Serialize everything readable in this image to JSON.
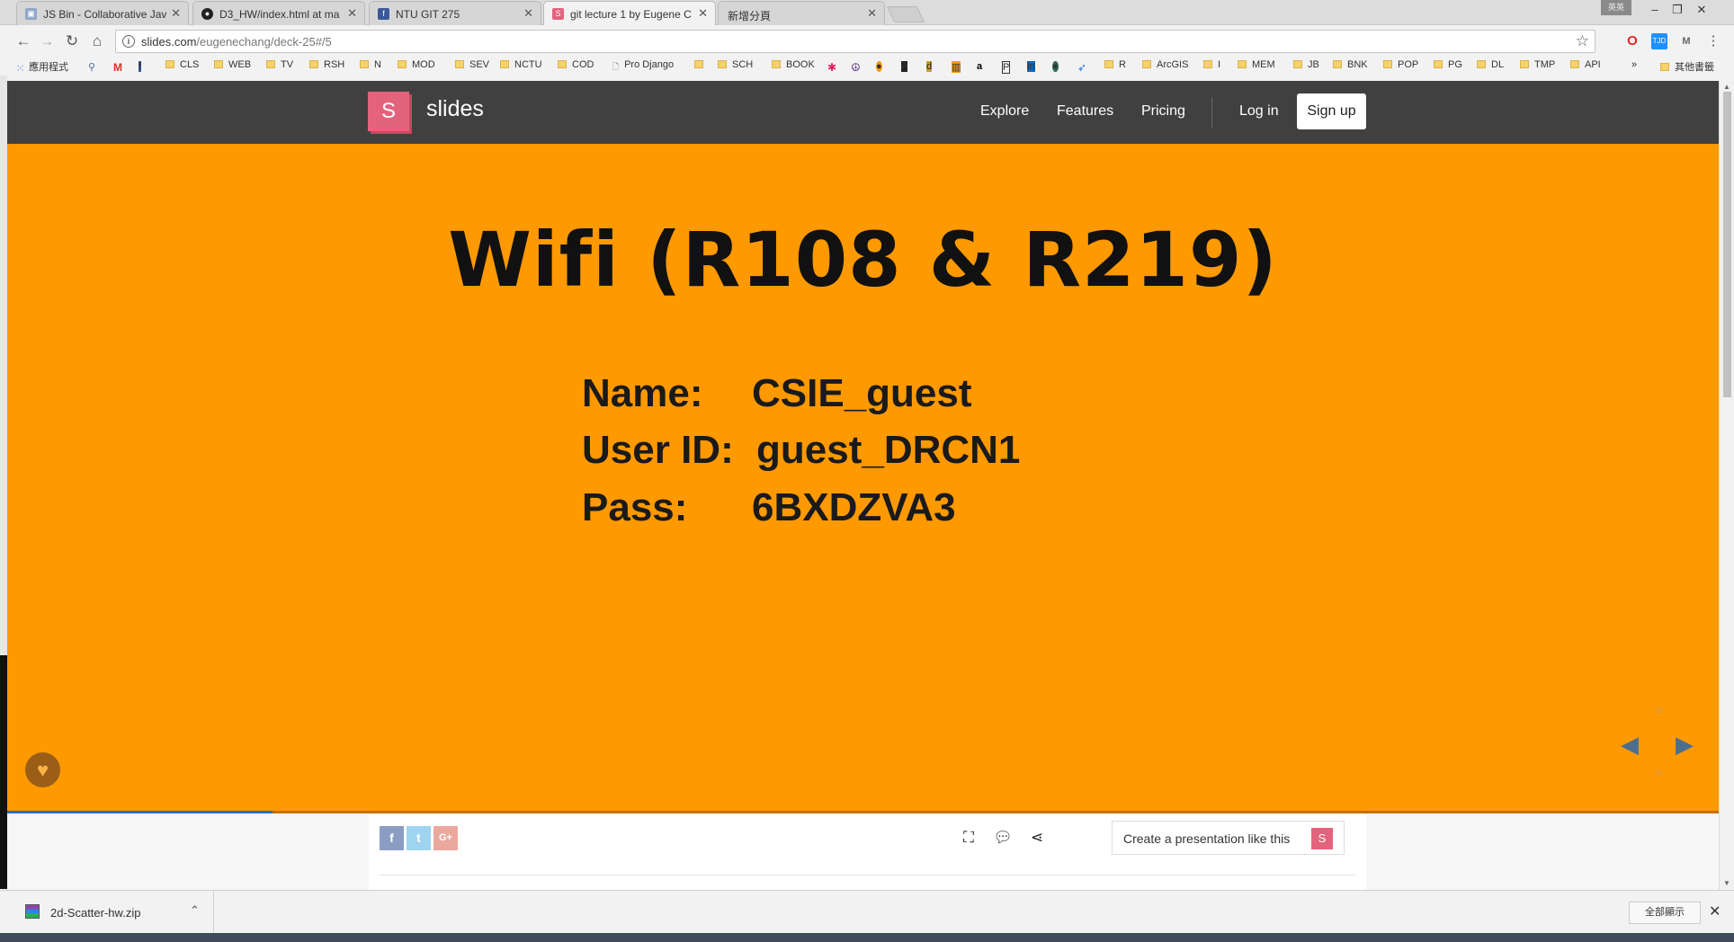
{
  "browser": {
    "tabs": [
      {
        "label": "JS Bin - Collaborative Jav",
        "favicon": "jsbin-icon",
        "active": false
      },
      {
        "label": "D3_HW/index.html at ma",
        "favicon": "github-icon",
        "active": false
      },
      {
        "label": "NTU GIT 275",
        "favicon": "facebook-icon",
        "active": false
      },
      {
        "label": "git lecture 1 by Eugene C",
        "favicon": "slides-icon",
        "active": true
      },
      {
        "label": "新增分頁",
        "favicon": "",
        "active": false
      }
    ],
    "ime_label": "英英",
    "url": "slides.com/eugenechang/deck-25#/5",
    "url_host": "slides.com",
    "url_path": "/eugenechang/deck-25#/5",
    "bookmarks": [
      "應用程式",
      "CLS",
      "WEB",
      "TV",
      "RSH",
      "N",
      "MOD",
      "SEV",
      "NCTU",
      "COD",
      "Pro Django",
      "SCH",
      "BOOK",
      "R",
      "ArcGIS",
      "I",
      "MEM",
      "JB",
      "BNK",
      "POP",
      "PG",
      "DL",
      "TMP",
      "API",
      "其他書籤"
    ],
    "bookmarks_overflow": "»"
  },
  "site": {
    "logo_letter": "S",
    "brand": "slides",
    "nav": {
      "explore": "Explore",
      "features": "Features",
      "pricing": "Pricing",
      "login": "Log in",
      "signup": "Sign up"
    }
  },
  "slide": {
    "title": "Wifi (R108 & R219)",
    "credentials": [
      {
        "label": "Name:",
        "value": "CSIE_guest"
      },
      {
        "label": "User ID:",
        "value": "guest_DRCN1"
      },
      {
        "label": "Pass:",
        "value": "6BXDZVA3"
      }
    ],
    "background": "#ff9900",
    "progress": 0.155
  },
  "footer": {
    "social": [
      "f",
      "t",
      "G+"
    ],
    "create_label": "Create a presentation like this",
    "create_badge": "S"
  },
  "downloads": {
    "file": "2d-Scatter-hw.zip",
    "show_all": "全部顯示"
  }
}
